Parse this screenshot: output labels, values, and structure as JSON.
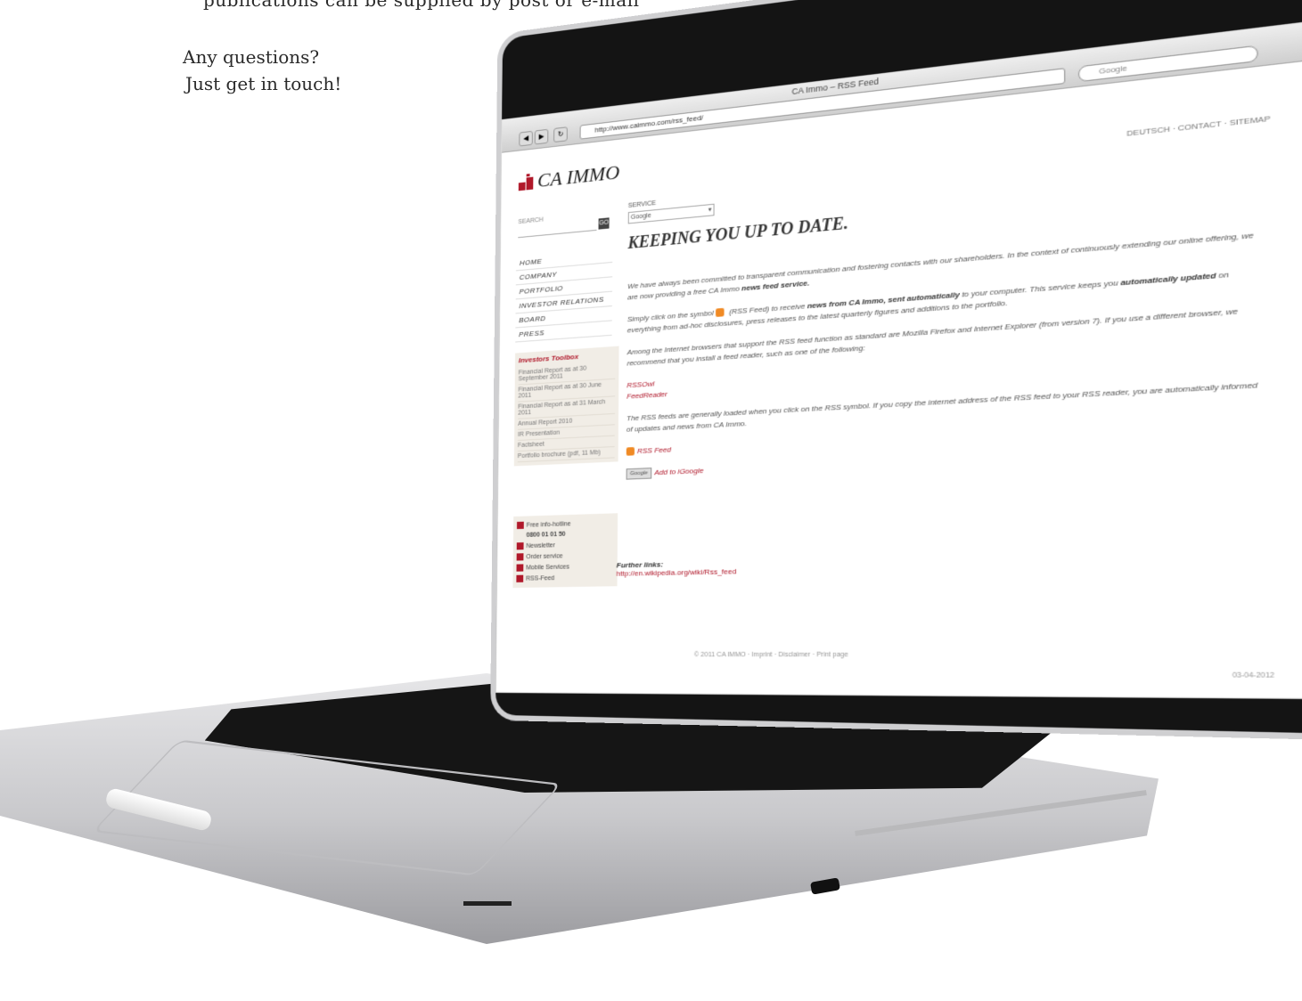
{
  "print": {
    "top_line": "publications can be supplied by post or e-mail",
    "question": "Any questions?",
    "cta": "Just get in touch!"
  },
  "browser": {
    "tab_title": "CA Immo – RSS Feed",
    "url": "http://www.caimmo.com/rss_feed/",
    "search_placeholder": "Google",
    "back_label": "◀",
    "fwd_label": "▶",
    "reload_label": "↻"
  },
  "site": {
    "logo_text": "CA IMMO",
    "top_links": "DEUTSCH · CONTACT · SITEMAP",
    "search_label": "SEARCH",
    "search_go": "GO",
    "service_label": "SERVICE",
    "service_value": "Google",
    "nav": [
      "HOME",
      "COMPANY",
      "PORTFOLIO",
      "INVESTOR RELATIONS",
      "BOARD",
      "PRESS"
    ],
    "toolbox_title": "Investors Toolbox",
    "toolbox_items": [
      "Financial Report as at 30 September 2011",
      "Financial Report as at 30 June 2011",
      "Financial Report as at 31 March 2011",
      "Annual Report 2010",
      "IR Presentation",
      "Factsheet",
      "Portfolio brochure (pdf, 11 Mb)"
    ],
    "contact_items": [
      "Free info-hotline",
      "0800 01 01 50",
      "Newsletter",
      "Order service",
      "Mobile Services",
      "RSS-Feed"
    ],
    "headline": "KEEPING YOU UP TO DATE.",
    "p1": "We have always been committed to transparent communication and fostering contacts with our shareholders. In the context of continuously extending our online offering, we are now providing a free CA Immo ",
    "p1_bold": "news feed service.",
    "p2_a": "Simply click on the symbol ",
    "p2_b": " (RSS Feed) to receive ",
    "p2_bold1": "news from CA Immo, sent automatically",
    "p2_c": " to your computer. This service keeps you ",
    "p2_bold2": "automatically updated",
    "p2_d": " on everything from ad-hoc disclosures, press releases to the latest quarterly figures and additions to the portfolio.",
    "p3": "Among the Internet browsers that support the RSS feed function as standard are Mozilla Firefox and Internet Explorer (from version 7). If you use a different browser, we recommend that you install a feed reader, such as one of the following:",
    "reader1": "RSSOwl",
    "reader2": "FeedReader",
    "p4": "The RSS feeds are generally loaded when you click on the RSS symbol. If you copy the internet address of the RSS feed to your RSS reader, you are automatically informed of updates and news from CA Immo.",
    "rss_link": "RSS Feed",
    "google_badge": "Google",
    "google_link": "Add to iGoogle",
    "further_title": "Further links:",
    "further_link": "http://en.wikipedia.org/wiki/Rss_feed",
    "footer": "© 2011 CA IMMO · Imprint · Disclaimer · Print page",
    "footer_date": "03-04-2012"
  }
}
